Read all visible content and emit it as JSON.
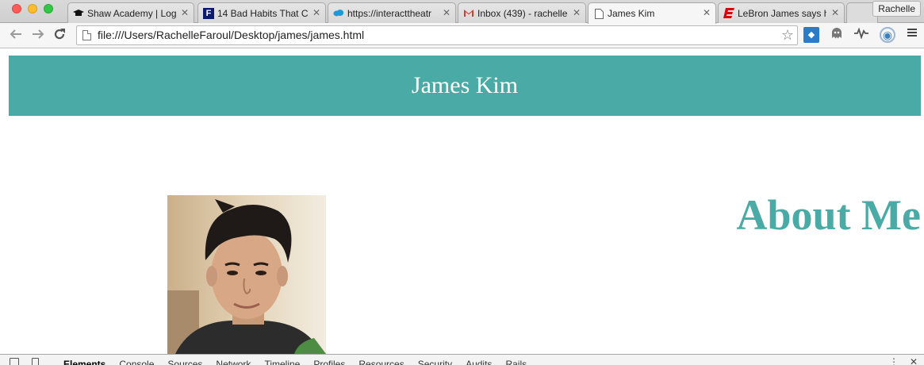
{
  "browser": {
    "tabs": [
      {
        "title": "Shaw Academy | Log",
        "icon": "graduation-cap-icon",
        "active": false
      },
      {
        "title": "14 Bad Habits That C",
        "icon": "forbes-f-icon",
        "active": false
      },
      {
        "title": "https://interacttheatr",
        "icon": "salesforce-cloud-icon",
        "active": false
      },
      {
        "title": "Inbox (439) - rachelle",
        "icon": "gmail-icon",
        "active": false
      },
      {
        "title": "James Kim",
        "icon": "page-icon",
        "active": true
      },
      {
        "title": "LeBron James says h",
        "icon": "espn-icon",
        "active": false
      }
    ],
    "tab_close_glyph": "✕",
    "profile_name": "Rachelle",
    "url": "file:///Users/RachelleFaroul/Desktop/james/james.html"
  },
  "page": {
    "header_title": "James Kim",
    "about_heading": "About Me",
    "portrait_alt": "portrait photo",
    "accent_color": "#4aaaa5"
  },
  "devtools": {
    "tabs": [
      "Elements",
      "Console",
      "Sources",
      "Network",
      "Timeline",
      "Profiles",
      "Resources",
      "Security",
      "Audits",
      "Rails"
    ],
    "active_tab": "Elements"
  }
}
